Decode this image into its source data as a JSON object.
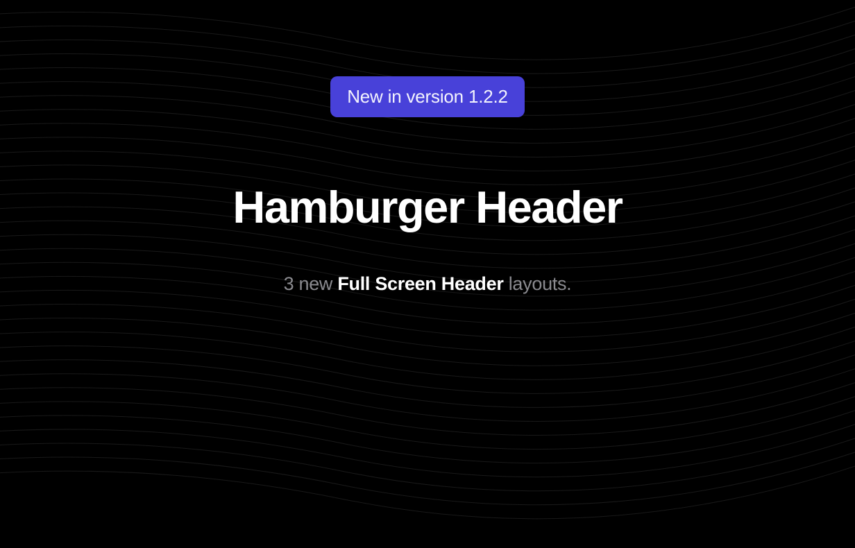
{
  "badge": {
    "label": "New in version 1.2.2"
  },
  "title": "Hamburger Header",
  "subtitle": {
    "prefix": "3 new ",
    "highlight": "Full Screen Header",
    "suffix": " layouts."
  }
}
